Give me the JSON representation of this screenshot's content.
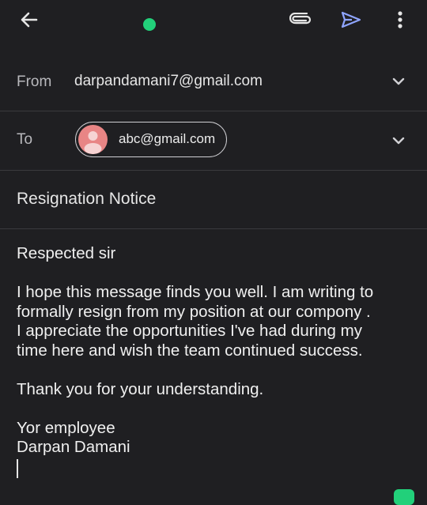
{
  "colors": {
    "background": "#1f1f22",
    "accent_green": "#22d07a",
    "send_blue": "#8fa5ff",
    "avatar": "#e88585"
  },
  "toolbar": {
    "icons": [
      "back-arrow-icon",
      "attach-icon",
      "send-icon",
      "more-vert-icon"
    ]
  },
  "from": {
    "label": "From",
    "value": "darpandamani7@gmail.com"
  },
  "to": {
    "label": "To",
    "recipient": "abc@gmail.com"
  },
  "subject": "Resignation Notice",
  "body": {
    "greeting": "Respected sir",
    "line1": "I hope this message finds you well. I am writing to",
    "line2": "formally resign from my position at our compony .",
    "line3": "I appreciate the opportunities I've had during my",
    "line4": "time here and wish the team continued success.",
    "thanks": "Thank you for your understanding.",
    "closing": "Yor employee",
    "signature": "Darpan Damani"
  }
}
